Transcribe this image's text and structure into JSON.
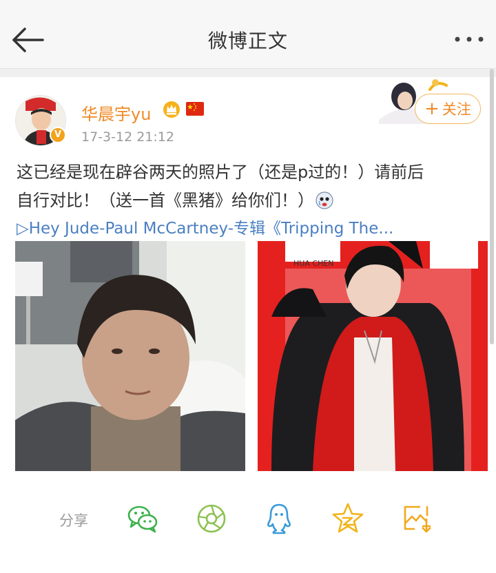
{
  "header": {
    "title": "微博正文",
    "back_icon": "arrow-left-icon",
    "more_icon": "more-dots-icon"
  },
  "post": {
    "username": "华晨宇yu",
    "timestamp": "17-3-12 21:12",
    "follow_label": "关注",
    "text_line1": "这已经是现在辟谷两天的照片了（还是p过的！）请前后",
    "text_line2": "自行对比！（送一首《黑猪》给你们！）",
    "music_link": "▷Hey Jude-Paul McCartney-专辑《Tripping The...",
    "photo_right_caption": "HUA CHEN"
  },
  "share": {
    "label": "分享",
    "targets": [
      {
        "name": "wechat",
        "icon": "wechat-icon",
        "color": "#3cb14a"
      },
      {
        "name": "moments",
        "icon": "moments-icon",
        "color": "#8cc152"
      },
      {
        "name": "qq",
        "icon": "qq-icon",
        "color": "#3a9ad9"
      },
      {
        "name": "qzone",
        "icon": "qzone-star-icon",
        "color": "#f2b31b"
      },
      {
        "name": "save-image",
        "icon": "save-image-icon",
        "color": "#f2a81b"
      }
    ]
  },
  "colors": {
    "username": "#ef8a26",
    "link": "#4a7fc1",
    "muted": "#9a9a9a",
    "accent_red": "#e02020"
  }
}
